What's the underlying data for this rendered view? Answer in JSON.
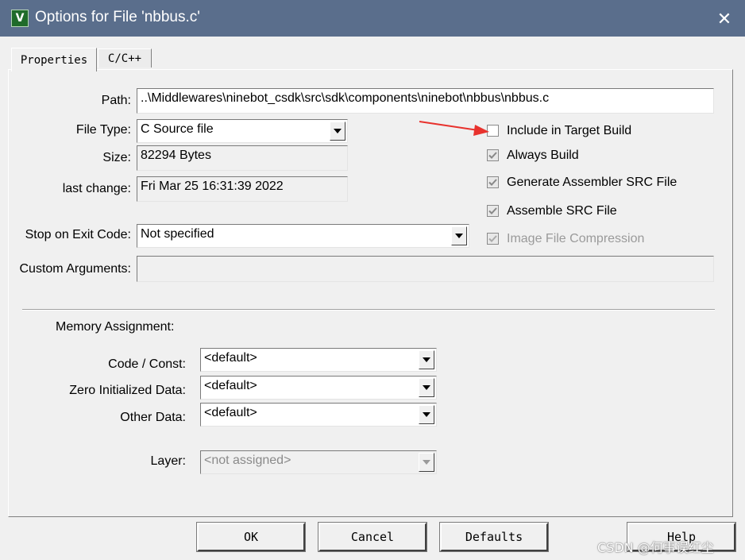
{
  "window": {
    "title": "Options for File 'nbbus.c'",
    "icon": "keil-uvision-icon",
    "close_glyph": "✕"
  },
  "tabs": [
    {
      "label": "Properties",
      "active": true
    },
    {
      "label": "C/C++",
      "active": false
    }
  ],
  "properties": {
    "path_label": "Path:",
    "path_value": "..\\Middlewares\\ninebot_csdk\\src\\sdk\\components\\ninebot\\nbbus\\nbbus.c",
    "file_type_label": "File Type:",
    "file_type_value": "C Source file",
    "size_label": "Size:",
    "size_value": "82294 Bytes",
    "last_change_label": "last change:",
    "last_change_value": "Fri Mar 25 16:31:39 2022",
    "stop_on_exit_label": "Stop on Exit Code:",
    "stop_on_exit_value": "Not specified",
    "custom_args_label": "Custom Arguments:",
    "custom_args_value": ""
  },
  "options": [
    {
      "label": "Include in Target Build",
      "checked": false,
      "enabled": true
    },
    {
      "label": "Always Build",
      "checked": true,
      "enabled": true
    },
    {
      "label": "Generate Assembler SRC File",
      "checked": true,
      "enabled": true
    },
    {
      "label": "Assemble SRC File",
      "checked": true,
      "enabled": true
    },
    {
      "label": "Image File Compression",
      "checked": true,
      "enabled": false
    }
  ],
  "memory": {
    "heading": "Memory Assignment:",
    "code_const_label": "Code / Const:",
    "code_const_value": "<default>",
    "zero_init_label": "Zero Initialized Data:",
    "zero_init_value": "<default>",
    "other_label": "Other Data:",
    "other_value": "<default>",
    "layer_label": "Layer:",
    "layer_value": "<not assigned>"
  },
  "buttons": {
    "ok": "OK",
    "cancel": "Cancel",
    "defaults": "Defaults",
    "help": "Help"
  },
  "annotation": {
    "arrow_color": "#e8322d"
  },
  "watermark": "CSDN @何事误红尘"
}
